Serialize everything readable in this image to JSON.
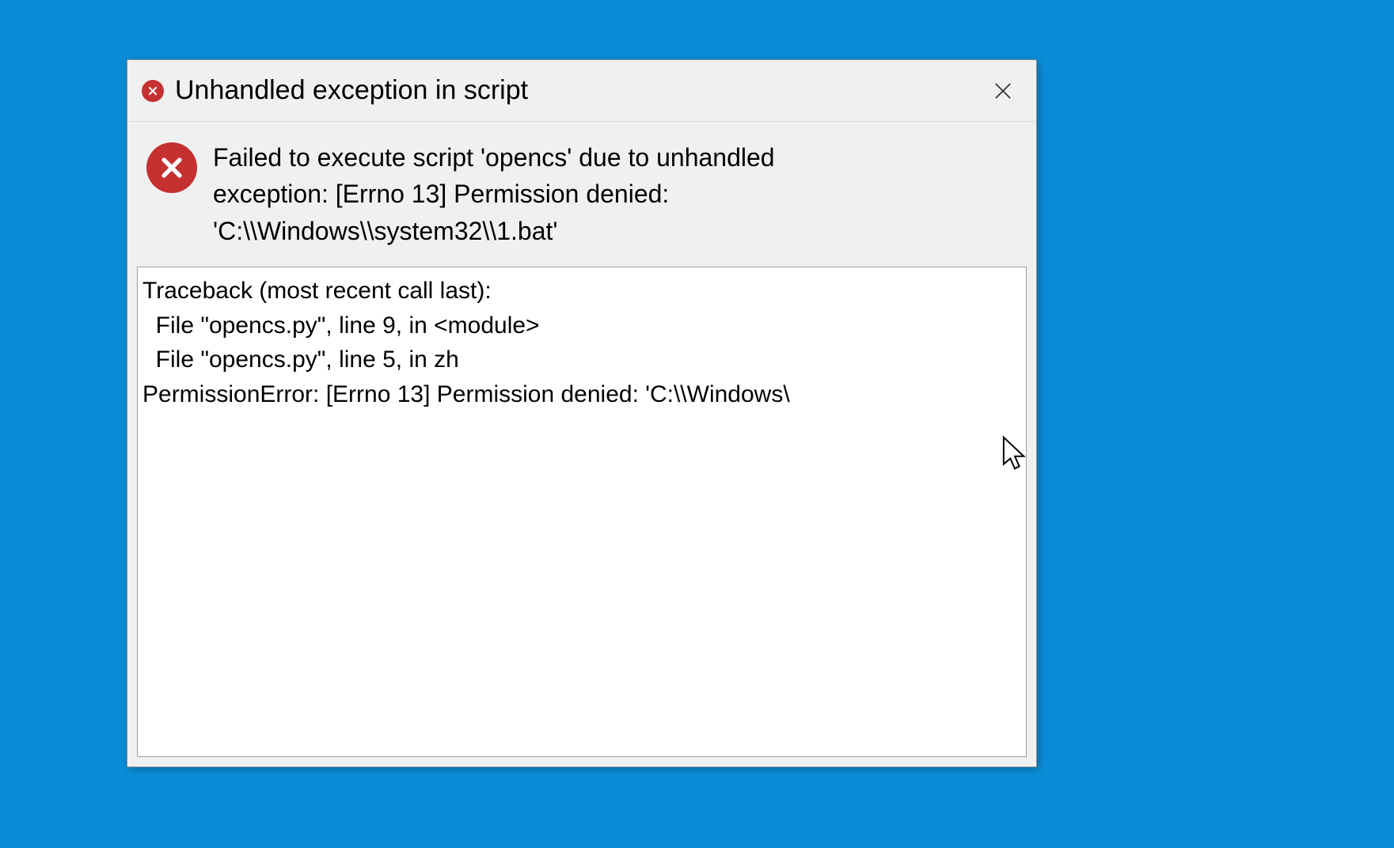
{
  "dialog": {
    "title": "Unhandled exception in script",
    "message": "Failed to execute script 'opencs' due to unhandled\nexception: [Errno 13] Permission denied:\n'C:\\\\Windows\\\\system32\\\\1.bat'",
    "traceback": "Traceback (most recent call last):\n  File \"opencs.py\", line 9, in <module>\n  File \"opencs.py\", line 5, in zh\nPermissionError: [Errno 13] Permission denied: 'C:\\\\Windows\\"
  },
  "icons": {
    "error_small": "error-icon",
    "error_large": "error-icon",
    "close": "close-icon"
  }
}
